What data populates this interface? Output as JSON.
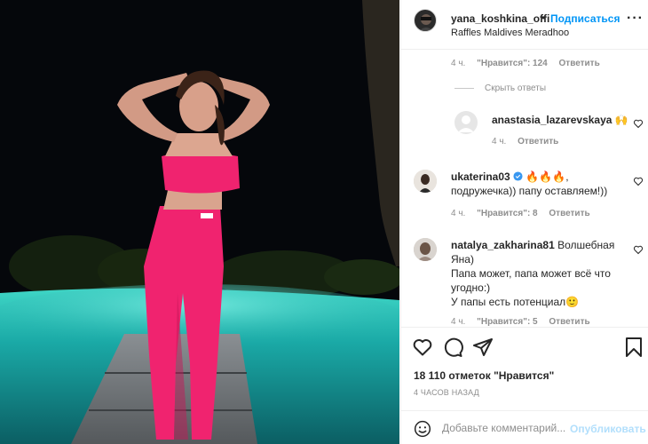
{
  "post": {
    "author": "yana_koshkina_offi",
    "follow_label": "Подписаться",
    "separator": "•",
    "location": "Raffles Maldives Meradhoo",
    "more_label": "···",
    "photo_icon": "post-photo"
  },
  "comments": {
    "first_meta": {
      "time": "4 ч.",
      "likes": "\"Нравится\": 124",
      "reply": "Ответить"
    },
    "hide_replies_label": "Скрыть ответы",
    "reply_item": {
      "user": "anastasia_lazarevskaya",
      "text": "🙌",
      "time": "4 ч.",
      "reply": "Ответить"
    },
    "items": [
      {
        "user": "ukaterina03",
        "text_line1": " 🔥🔥🔥,",
        "text_line2": "подружечка)) папу оставляем!))",
        "time": "4 ч.",
        "likes": "\"Нравится\": 8",
        "reply": "Ответить"
      },
      {
        "user": "natalya_zakharina81",
        "text_line1": " Волшебная",
        "text_line2": "Яна)",
        "text_line3": "Папа может, папа может всё что",
        "text_line4": "угодно:)",
        "text_line5": "У папы есть потенциал🙂",
        "time": "4 ч.",
        "likes": "\"Нравится\": 5",
        "reply": "Ответить"
      }
    ]
  },
  "actions": {
    "icons": [
      "heart-icon",
      "comment-icon",
      "share-icon",
      "bookmark-icon"
    ]
  },
  "likes_text": "18 110 отметок \"Нравится\"",
  "timestamp": "4 ЧАСОВ НАЗАД",
  "composer": {
    "placeholder": "Добавьте комментарий...",
    "publish_label": "Опубликовать"
  },
  "colors": {
    "accent": "#0095f6",
    "publish_disabled": "#b2dffc",
    "secondary_text": "#8e8e8e",
    "verified": "#3897f0"
  }
}
